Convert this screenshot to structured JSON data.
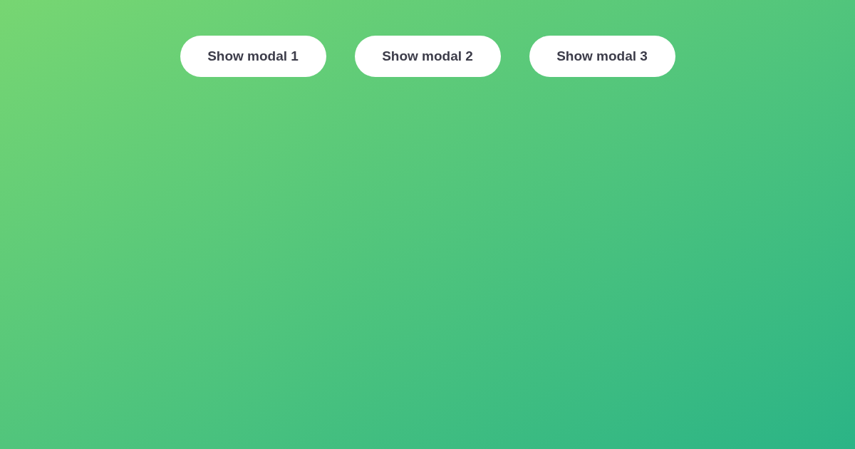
{
  "buttons": [
    {
      "label": "Show modal 1"
    },
    {
      "label": "Show modal 2"
    },
    {
      "label": "Show modal 3"
    }
  ]
}
